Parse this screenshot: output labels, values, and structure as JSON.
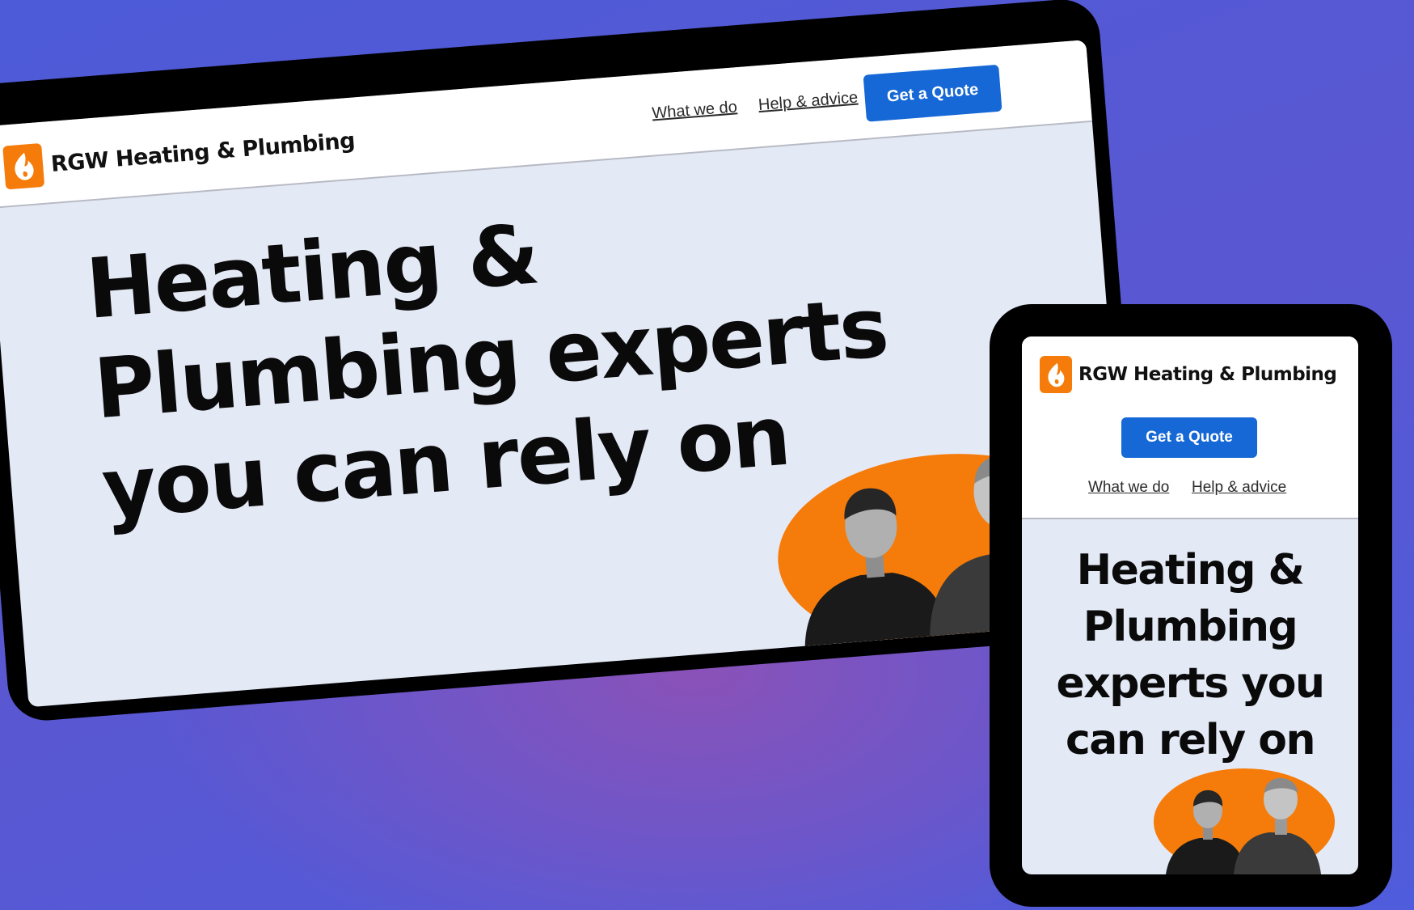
{
  "brand": {
    "name": "RGW Heating & Plumbing",
    "accent": "#f57c0a",
    "cta_color": "#1668d6"
  },
  "tablet": {
    "nav": {
      "what_we_do": "What we do",
      "help_advice": "Help & advice"
    },
    "cta": "Get a Quote",
    "hero": {
      "line1": "Heating &",
      "line2": "Plumbing experts",
      "line3": "you can rely on"
    }
  },
  "phone": {
    "cta": "Get a Quote",
    "nav": {
      "what_we_do": "What we do",
      "help_advice": "Help & advice"
    },
    "hero": {
      "line1": "Heating &",
      "line2": "Plumbing",
      "line3": "experts you",
      "line4": "can rely on"
    }
  },
  "icons": {
    "logo": "flame-icon"
  }
}
